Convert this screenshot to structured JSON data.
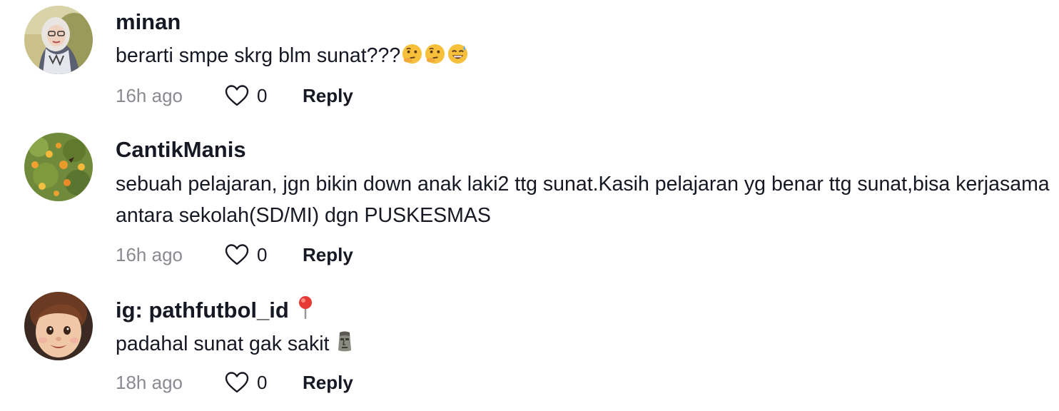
{
  "comments": [
    {
      "username": "minan",
      "text": "berarti smpe skrg blm sunat???",
      "emojis": [
        "thinking-face",
        "thinking-face",
        "grinning-sweat-face"
      ],
      "time": "16h ago",
      "likes": "0",
      "reply_label": "Reply"
    },
    {
      "username": "CantikManis",
      "text": "sebuah pelajaran, jgn bikin down anak laki2 ttg sunat.Kasih pelajaran yg benar ttg sunat,bisa kerjasama antara sekolah(SD/MI) dgn PUSKESMAS",
      "time": "16h ago",
      "likes": "0",
      "reply_label": "Reply"
    },
    {
      "username": "ig: pathfutbol_id",
      "username_emoji": "round-pushpin",
      "text": "padahal sunat gak sakit",
      "text_emoji": "moai",
      "time": "18h ago",
      "likes": "0",
      "reply_label": "Reply"
    }
  ],
  "colors": {
    "text": "#161823",
    "muted": "#8a8b91",
    "heart_outline": "#161823"
  }
}
